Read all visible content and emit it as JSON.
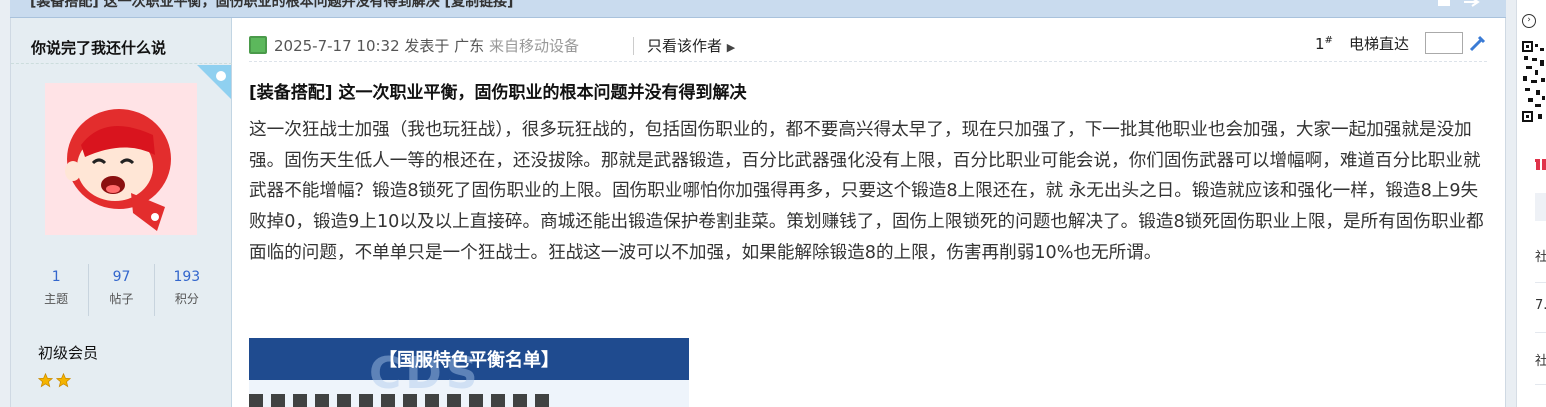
{
  "topbar": {
    "title": "[装备搭配] 这一次职业平衡，固伤职业的根本问题并没有得到解决 [复制链接]"
  },
  "author": {
    "username": "你说完了我还什么说",
    "stats": [
      {
        "value": "1",
        "label": "主题"
      },
      {
        "value": "97",
        "label": "帖子"
      },
      {
        "value": "193",
        "label": "积分"
      }
    ],
    "group": "初级会员",
    "stars": 2
  },
  "post": {
    "date": "2025-7-17 10:32",
    "posted_at": "发表于 广东",
    "device": "来自移动设备",
    "only_author": "只看该作者",
    "floor": "1",
    "floor_mark": "#",
    "jump_label": "电梯直达",
    "title": "[装备搭配] 这一次职业平衡，固伤职业的根本问题并没有得到解决",
    "body": "这一次狂战士加强（我也玩狂战），很多玩狂战的，包括固伤职业的，都不要高兴得太早了，现在只加强了，下一批其他职业也会加强，大家一起加强就是没加强。固伤天生低人一等的根还在，还没拔除。那就是武器锻造，百分比武器强化没有上限，百分比职业可能会说，你们固伤武器可以增幅啊，难道百分比职业就武器不能增幅？锻造8锁死了固伤职业的上限。固伤职业哪怕你加强得再多，只要这个锻造8上限还在，就 永无出头之日。锻造就应该和强化一样，锻造8上9失败掉0，锻造9上10以及以上直接碎。商城还能出锻造保护卷割韭菜。策划赚钱了，固伤上限锁死的问题也解决了。锻造8锁死固伤职业上限，是所有固伤职业都面临的问题，不单单只是一个狂战士。狂战这一波可以不加强，如果能解除锻造8的上限，伤害再削弱10%也无所谓。",
    "attachment_title": "【国服特色平衡名单】"
  },
  "sidebar": {
    "items": [
      "社",
      "7.",
      "社"
    ]
  },
  "colors": {
    "link": "#3366cc",
    "accent": "#1f4b8f",
    "author_bg": "#e5edf2"
  }
}
